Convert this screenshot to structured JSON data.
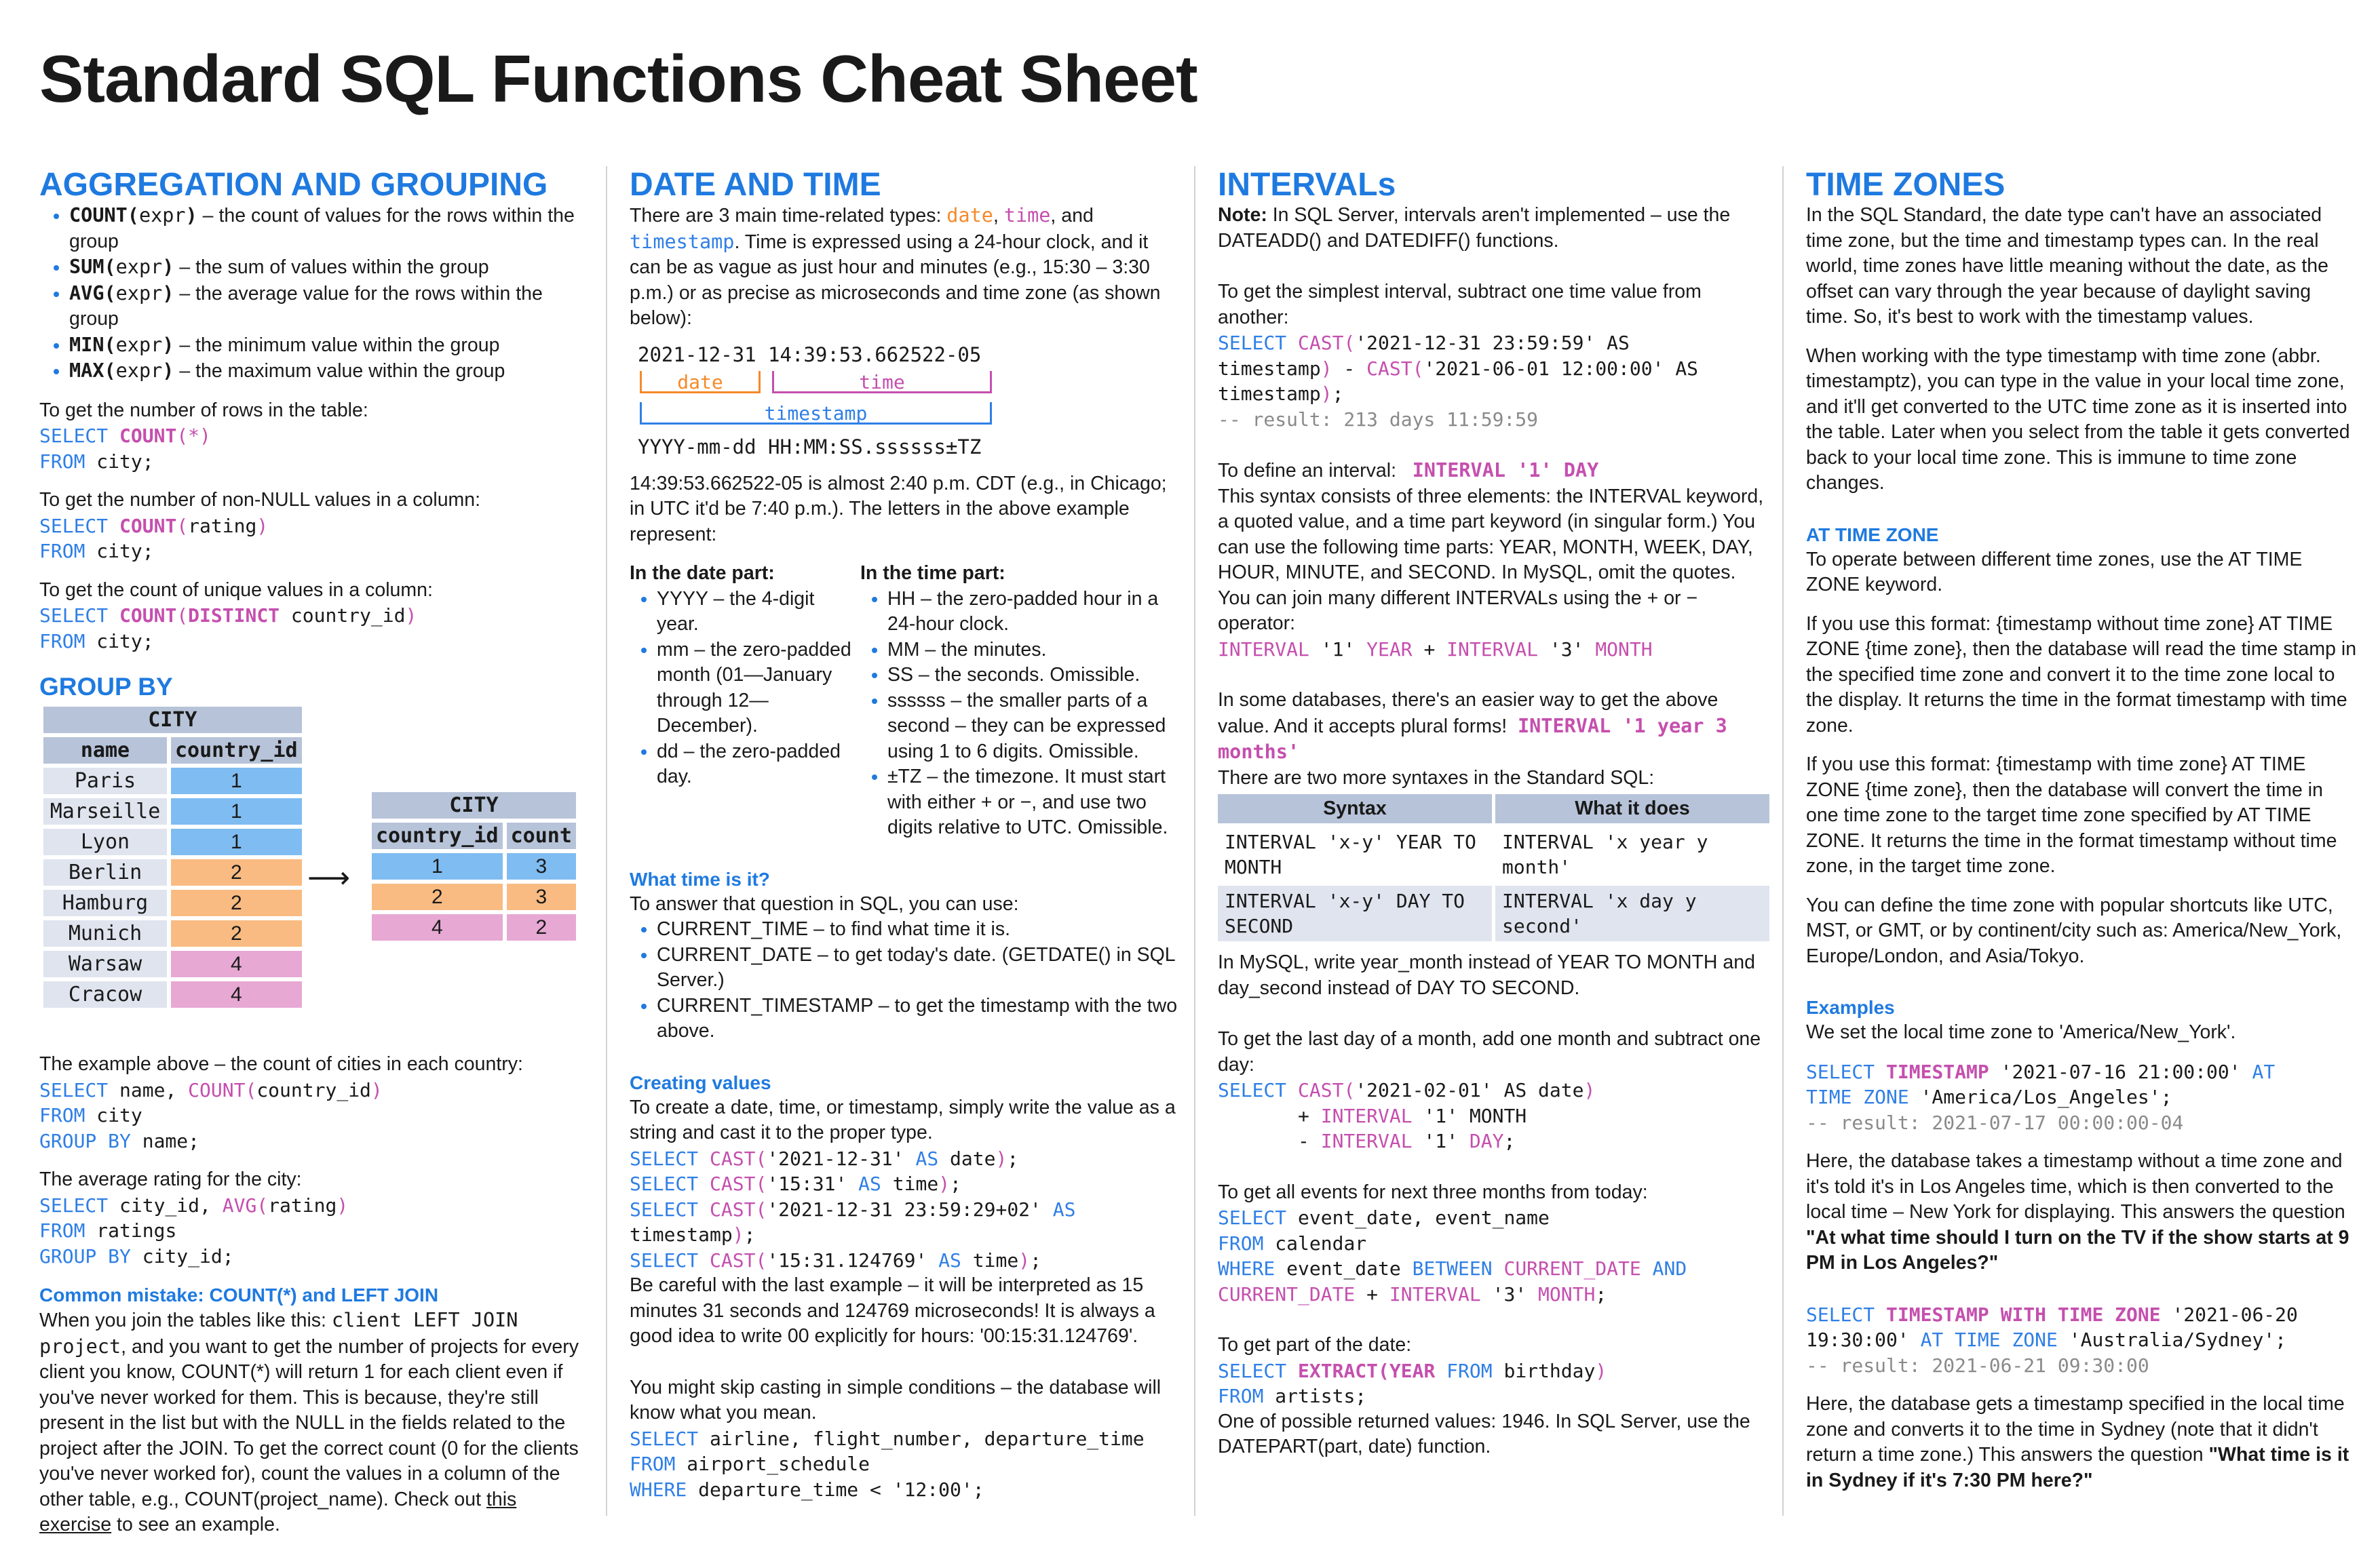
{
  "title": "Standard SQL Functions Cheat Sheet",
  "agg": {
    "heading": "AGGREGATION AND GROUPING",
    "items": [
      {
        "fn": "COUNT(",
        "arg": "expr",
        "close": ")",
        "desc": " – the count of values for the rows within the group"
      },
      {
        "fn": "SUM(",
        "arg": "expr",
        "close": ")",
        "desc": " – the sum of values within the group"
      },
      {
        "fn": "AVG(",
        "arg": "expr",
        "close": ")",
        "desc": " – the average value for the rows within the group"
      },
      {
        "fn": "MIN(",
        "arg": "expr",
        "close": ")",
        "desc": " – the minimum value within the group"
      },
      {
        "fn": "MAX(",
        "arg": "expr",
        "close": ")",
        "desc": " – the maximum value within the group"
      }
    ],
    "rows_text": "To get the number of rows in the table:",
    "nonnull_text": "To get the number of non-NULL values in a column:",
    "unique_text": "To get the count of unique values in a column:",
    "groupby_heading": "GROUP BY",
    "city_table": {
      "caption": "CITY",
      "headers": [
        "name",
        "country_id"
      ],
      "rows": [
        [
          "Paris",
          "1"
        ],
        [
          "Marseille",
          "1"
        ],
        [
          "Lyon",
          "1"
        ],
        [
          "Berlin",
          "2"
        ],
        [
          "Hamburg",
          "2"
        ],
        [
          "Munich",
          "2"
        ],
        [
          "Warsaw",
          "4"
        ],
        [
          "Cracow",
          "4"
        ]
      ]
    },
    "result_table": {
      "caption": "CITY",
      "headers": [
        "country_id",
        "count"
      ],
      "rows": [
        [
          "1",
          "3"
        ],
        [
          "2",
          "3"
        ],
        [
          "4",
          "2"
        ]
      ]
    },
    "example_text": "The example above – the count of cities in each country:",
    "avg_text": "The average rating for the city:",
    "mistake_heading": "Common mistake: COUNT(*) and LEFT JOIN",
    "mistake_p1": "When you join the tables like this: ",
    "mistake_code1": "client LEFT JOIN project",
    "mistake_p2": ", and you want to get the number of projects for every client you know, COUNT(*) will return 1 for each client even if you've never worked for them. This is because, they're still present in the list but with the NULL in the fields related to the project after the JOIN. To get the correct count (0 for the clients you've never worked for), count the values in a column of the other table, e.g., COUNT(project_name). Check out ",
    "mistake_link": "this exercise",
    "mistake_p3": " to see an example."
  },
  "date": {
    "heading": "DATE AND TIME",
    "intro1": "There are 3 main time-related types: ",
    "type_date": "date",
    "type_time": "time",
    "type_ts": "timestamp",
    "intro2": ". Time is expressed using a 24-hour clock, and it can be as vague as just hour and minutes (e.g., 15:30 – 3:30 p.m.) or as precise as microseconds and time zone (as shown below):",
    "diag_value": "2021-12-31 14:39:53.662522-05",
    "diag_date": "date",
    "diag_time": "time",
    "diag_ts": "timestamp",
    "diag_format": "YYYY-mm-dd HH:MM:SS.ssssss±TZ",
    "explain": "14:39:53.662522-05 is almost 2:40 p.m. CDT (e.g., in Chicago; in UTC it'd be 7:40 p.m.). The letters in the above example represent:",
    "date_part_heading": "In the date part:",
    "date_part": [
      "YYYY – the 4-digit year.",
      "mm – the zero-padded month (01—January through 12—December).",
      "dd – the zero-padded day."
    ],
    "time_part_heading": "In the time part:",
    "time_part": [
      "HH – the zero-padded hour in a 24-hour clock.",
      "MM – the minutes.",
      "SS – the seconds. Omissible.",
      "ssssss – the smaller parts of a second – they can be expressed using 1 to 6 digits. Omissible.",
      "±TZ – the timezone. It must start with either + or −, and use two digits relative to UTC. Omissible."
    ],
    "what_heading": "What time is it?",
    "what_text": "To answer that question in SQL, you can use:",
    "what_items": [
      "CURRENT_TIME – to find what time it is.",
      "CURRENT_DATE – to get today's date. (GETDATE() in SQL Server.)",
      "CURRENT_TIMESTAMP – to get the timestamp with the two above."
    ],
    "create_heading": "Creating values",
    "create_text": "To create a date, time, or timestamp, simply write the value as a string and cast it to the proper type.",
    "careful_text": "Be careful with the last example – it will be interpreted as 15 minutes 31 seconds and 124769 microseconds! It is always a good idea to write 00 explicitly for hours: '00:15:31.124769'.",
    "skip_text": "You might skip casting in simple conditions – the database will know what you mean."
  },
  "intervals": {
    "heading": "INTERVALs",
    "note_label": "Note:",
    "note": " In SQL Server, intervals aren't implemented – use the DATEADD() and DATEDIFF() functions.",
    "simple_text": "To get the simplest interval, subtract one time value from another:",
    "result1": "-- result: 213 days 11:59:59",
    "define_text": "To define an interval:",
    "define_code": "INTERVAL '1' DAY",
    "define_body": "This syntax consists of three elements: the INTERVAL keyword, a quoted value, and a time part keyword (in singular form.) You can use the following time parts: YEAR, MONTH, WEEK, DAY, HOUR, MINUTE, and SECOND. In MySQL, omit the quotes. You can join many different INTERVALs using the + or − operator:",
    "easier_text": "In some databases, there's an easier way to get the above value. And it accepts plural forms!",
    "easier_code": "INTERVAL '1 year 3 months'",
    "two_more": "There are two more syntaxes in the Standard SQL:",
    "syntax_headers": [
      "Syntax",
      "What it does"
    ],
    "syntax_rows": [
      [
        "INTERVAL 'x-y' YEAR TO MONTH",
        "INTERVAL 'x year y month'"
      ],
      [
        "INTERVAL 'x-y' DAY TO SECOND",
        "INTERVAL 'x day y second'"
      ]
    ],
    "mysql_text": "In MySQL, write year_month instead of YEAR TO MONTH and day_second instead of DAY TO SECOND.",
    "lastday_text": "To get the last day of a month, add one month and subtract one day:",
    "events_text": "To get all events for next three months from today:",
    "part_text": "To get part of the date:",
    "part_result": "One of possible returned values: 1946. In SQL Server, use the DATEPART(part, date) function."
  },
  "tz": {
    "heading": "TIME ZONES",
    "p1": "In the SQL Standard, the date type can't have an associated time zone, but the time and timestamp types can. In the real world, time zones have little meaning without the date, as the offset can vary through the year because of daylight saving time. So, it's best to work with the timestamp values.",
    "p2": "When working with the type timestamp with time zone (abbr. timestamptz), you can type in the value in your local time zone, and it'll get converted to the UTC time zone as it is inserted into the table. Later when you select from the table it gets converted back to your local time zone. This is immune to time zone changes.",
    "atz_heading": "AT TIME ZONE",
    "atz_p1": "To operate between different time zones, use the AT TIME ZONE keyword.",
    "atz_p2": "If you use this format: {timestamp without time zone} AT TIME ZONE {time zone}, then the database will read the time stamp in the specified time zone and convert it to the time zone local to the display. It returns the time in the format timestamp with time zone.",
    "atz_p3": "If you use this format: {timestamp with time zone} AT TIME ZONE {time zone}, then the database will convert the time in one time zone to the target time zone specified by AT TIME ZONE. It returns the time in the format timestamp without time zone, in the target time zone.",
    "atz_p4": "You can define the time zone with popular shortcuts like UTC, MST, or GMT, or by continent/city such as: America/New_York, Europe/London, and Asia/Tokyo.",
    "ex_heading": "Examples",
    "ex_intro": "We set the local time zone to 'America/New_York'.",
    "ex1_result": "-- result: 2021-07-17 00:00:00-04",
    "ex1_text": "Here, the database takes a timestamp without a time zone and it's told it's in Los Angeles time, which is then converted to the local time – New York for displaying. This answers the question ",
    "ex1_q": "\"At what time should I turn on the TV if the show starts at 9 PM in Los Angeles?\"",
    "ex2_result": "-- result: 2021-06-21 09:30:00",
    "ex2_text": "Here, the database gets a timestamp specified in the local time zone and converts it to the time in Sydney (note that it didn't return a time zone.) This answers the question ",
    "ex2_q": "\"What time is it in Sydney if it's 7:30 PM here?\""
  }
}
